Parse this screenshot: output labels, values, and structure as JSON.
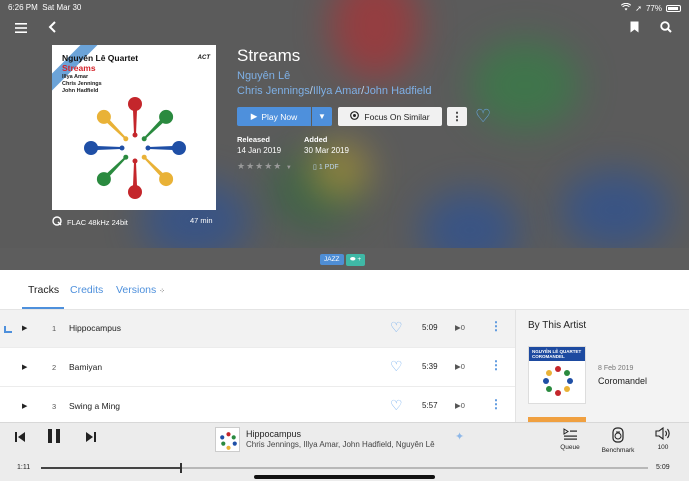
{
  "status_bar": {
    "time": "6:26 PM",
    "date": "Sat Mar 30",
    "battery": "77%"
  },
  "album": {
    "title": "Streams",
    "primary_artist": "Nguyên Lê",
    "other_artists": [
      "Chris Jennings",
      "Illya Amar",
      "John Hadfield"
    ],
    "separator": "/",
    "cover": {
      "artist": "Nguyên Lê Quartet",
      "title": "Streams",
      "label": "ACT",
      "musicians": [
        "Illya Amar",
        "Chris Jennings",
        "John Hadfield"
      ]
    },
    "format": "FLAC 48kHz 24bit",
    "duration": "47 min",
    "released_label": "Released",
    "released": "14 Jan 2019",
    "added_label": "Added",
    "added": "30 Mar 2019",
    "rating_stars": "★★★★★",
    "rating_value": 0,
    "pdf_label": "1 PDF",
    "genre": "JAZZ",
    "tag_symbol": "+"
  },
  "actions": {
    "play_now": "Play Now",
    "focus_on_similar": "Focus On Similar"
  },
  "tabs": [
    {
      "label": "Tracks",
      "active": true
    },
    {
      "label": "Credits",
      "active": false
    },
    {
      "label": "Versions",
      "active": false
    }
  ],
  "tracks": [
    {
      "number": "1",
      "title": "Hippocampus",
      "duration": "5:09",
      "plays": "0",
      "playing": true
    },
    {
      "number": "2",
      "title": "Bamiyan",
      "duration": "5:39",
      "plays": "0",
      "playing": false
    },
    {
      "number": "3",
      "title": "Swing a Ming",
      "duration": "5:57",
      "plays": "0",
      "playing": false
    }
  ],
  "by_artist": {
    "heading": "By This Artist",
    "cover_artist": "NGUYÊN LÊ QUARTET",
    "cover_title": "COROMANDEL",
    "date": "8 Feb 2019",
    "album": "Coromandel"
  },
  "player": {
    "title": "Hippocampus",
    "artists": "Chris Jennings, Illya Amar, John Hadfield, Nguyên Lê",
    "elapsed": "1:11",
    "total": "5:09",
    "progress_fraction": 0.23,
    "queue_label": "Queue",
    "benchmark_label": "Benchmark",
    "volume": "100"
  },
  "colors": {
    "accent": "#4e90dc",
    "link": "#7eb0e6",
    "heart": "#6ba9ee",
    "genre_jazz": "#4f8ed5",
    "genre_tag": "#3fb8a6"
  }
}
